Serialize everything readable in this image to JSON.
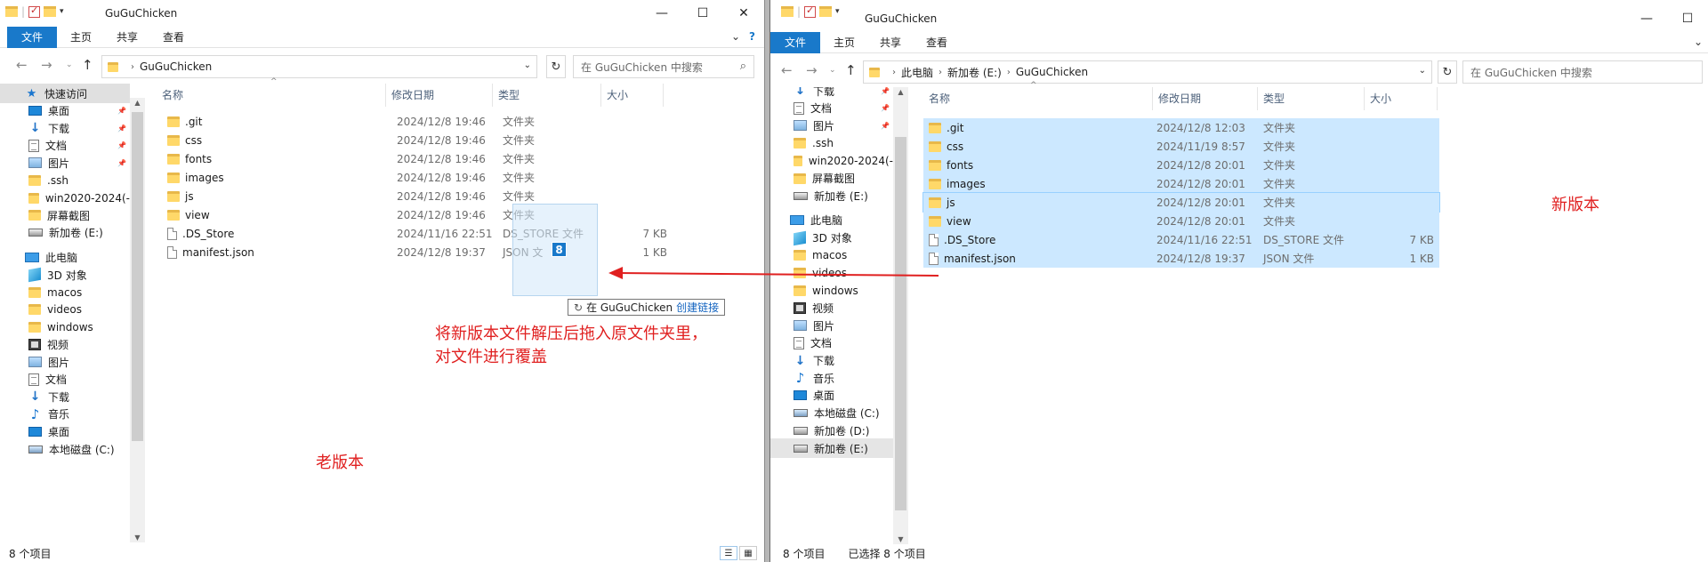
{
  "left": {
    "title": "GuGuChicken",
    "tabs": [
      "文件",
      "主页",
      "共享",
      "查看"
    ],
    "address": [
      "GuGuChicken"
    ],
    "search_placeholder": "在 GuGuChicken 中搜索",
    "columns": {
      "name": "名称",
      "date": "修改日期",
      "type": "类型",
      "size": "大小"
    },
    "sidebar": [
      {
        "label": "快速访问",
        "icon": "star-icon",
        "kind": "qa"
      },
      {
        "label": "桌面",
        "icon": "desktop-icon",
        "pin": true
      },
      {
        "label": "下载",
        "icon": "download-icon",
        "pin": true
      },
      {
        "label": "文档",
        "icon": "document-icon",
        "pin": true
      },
      {
        "label": "图片",
        "icon": "picture-icon",
        "pin": true
      },
      {
        "label": ".ssh",
        "icon": "folder-icon"
      },
      {
        "label": "win2020-2024(-",
        "icon": "folder-icon"
      },
      {
        "label": "屏幕截图",
        "icon": "folder-icon"
      },
      {
        "label": "新加卷 (E:)",
        "icon": "drive-icon"
      },
      {
        "label": "此电脑",
        "icon": "computer-icon",
        "kind": "root"
      },
      {
        "label": "3D 对象",
        "icon": "3d-objects-icon"
      },
      {
        "label": "macos",
        "icon": "folder-icon"
      },
      {
        "label": "videos",
        "icon": "folder-icon"
      },
      {
        "label": "windows",
        "icon": "folder-icon"
      },
      {
        "label": "视频",
        "icon": "video-icon"
      },
      {
        "label": "图片",
        "icon": "picture-icon"
      },
      {
        "label": "文档",
        "icon": "document-icon"
      },
      {
        "label": "下载",
        "icon": "download-icon"
      },
      {
        "label": "音乐",
        "icon": "music-icon"
      },
      {
        "label": "桌面",
        "icon": "desktop-icon"
      },
      {
        "label": "本地磁盘 (C:)",
        "icon": "drive-icon"
      }
    ],
    "files": [
      {
        "name": ".git",
        "date": "2024/12/8 19:46",
        "type": "文件夹",
        "size": "",
        "icon": "folder-icon"
      },
      {
        "name": "css",
        "date": "2024/12/8 19:46",
        "type": "文件夹",
        "size": "",
        "icon": "folder-icon"
      },
      {
        "name": "fonts",
        "date": "2024/12/8 19:46",
        "type": "文件夹",
        "size": "",
        "icon": "folder-icon"
      },
      {
        "name": "images",
        "date": "2024/12/8 19:46",
        "type": "文件夹",
        "size": "",
        "icon": "folder-icon"
      },
      {
        "name": "js",
        "date": "2024/12/8 19:46",
        "type": "文件夹",
        "size": "",
        "icon": "folder-icon"
      },
      {
        "name": "view",
        "date": "2024/12/8 19:46",
        "type": "文件夹",
        "size": "",
        "icon": "folder-icon"
      },
      {
        "name": ".DS_Store",
        "date": "2024/11/16 22:51",
        "type": "DS_STORE 文件",
        "size": "7 KB",
        "icon": "file-icon"
      },
      {
        "name": "manifest.json",
        "date": "2024/12/8 19:37",
        "type": "JSON 文",
        "size": "1 KB",
        "icon": "file-icon"
      }
    ],
    "status": "8 个项目"
  },
  "right": {
    "title": "GuGuChicken",
    "tabs": [
      "文件",
      "主页",
      "共享",
      "查看"
    ],
    "address": [
      "此电脑",
      "新加卷 (E:)",
      "GuGuChicken"
    ],
    "search_placeholder": "在 GuGuChicken 中搜索",
    "columns": {
      "name": "名称",
      "date": "修改日期",
      "type": "类型",
      "size": "大小"
    },
    "sidebar": [
      {
        "label": "下载",
        "icon": "download-icon",
        "pin": true
      },
      {
        "label": "文档",
        "icon": "document-icon",
        "pin": true
      },
      {
        "label": "图片",
        "icon": "picture-icon",
        "pin": true
      },
      {
        "label": ".ssh",
        "icon": "folder-icon"
      },
      {
        "label": "win2020-2024(-",
        "icon": "folder-icon"
      },
      {
        "label": "屏幕截图",
        "icon": "folder-icon"
      },
      {
        "label": "新加卷 (E:)",
        "icon": "drive-icon"
      },
      {
        "label": "此电脑",
        "icon": "computer-icon",
        "kind": "root"
      },
      {
        "label": "3D 对象",
        "icon": "3d-objects-icon"
      },
      {
        "label": "macos",
        "icon": "folder-icon"
      },
      {
        "label": "videos",
        "icon": "folder-icon"
      },
      {
        "label": "windows",
        "icon": "folder-icon"
      },
      {
        "label": "视频",
        "icon": "video-icon"
      },
      {
        "label": "图片",
        "icon": "picture-icon"
      },
      {
        "label": "文档",
        "icon": "document-icon"
      },
      {
        "label": "下载",
        "icon": "download-icon"
      },
      {
        "label": "音乐",
        "icon": "music-icon"
      },
      {
        "label": "桌面",
        "icon": "desktop-icon"
      },
      {
        "label": "本地磁盘 (C:)",
        "icon": "drive-icon"
      },
      {
        "label": "新加卷 (D:)",
        "icon": "drive-icon"
      },
      {
        "label": "新加卷 (E:)",
        "icon": "drive-icon",
        "kind": "current"
      }
    ],
    "files": [
      {
        "name": ".git",
        "date": "2024/12/8 12:03",
        "type": "文件夹",
        "size": "",
        "icon": "folder-icon"
      },
      {
        "name": "css",
        "date": "2024/11/19 8:57",
        "type": "文件夹",
        "size": "",
        "icon": "folder-icon"
      },
      {
        "name": "fonts",
        "date": "2024/12/8 20:01",
        "type": "文件夹",
        "size": "",
        "icon": "folder-icon"
      },
      {
        "name": "images",
        "date": "2024/12/8 20:01",
        "type": "文件夹",
        "size": "",
        "icon": "folder-icon"
      },
      {
        "name": "js",
        "date": "2024/12/8 20:01",
        "type": "文件夹",
        "size": "",
        "icon": "folder-icon"
      },
      {
        "name": "view",
        "date": "2024/12/8 20:01",
        "type": "文件夹",
        "size": "",
        "icon": "folder-icon"
      },
      {
        "name": ".DS_Store",
        "date": "2024/11/16 22:51",
        "type": "DS_STORE 文件",
        "size": "7 KB",
        "icon": "file-icon"
      },
      {
        "name": "manifest.json",
        "date": "2024/12/8 19:37",
        "type": "JSON 文件",
        "size": "1 KB",
        "icon": "file-icon"
      }
    ],
    "status": "8 个项目",
    "status_selected": "已选择 8 个项目"
  },
  "drag": {
    "count": "8",
    "tip_prefix": "在 GuGuChicken",
    "tip_action": "创建链接"
  },
  "annotations": {
    "old": "老版本",
    "new": "新版本",
    "instruction_line1": "将新版本文件解压后拖入原文件夹里，",
    "instruction_line2": "对文件进行覆盖",
    "color": "#e02020"
  }
}
